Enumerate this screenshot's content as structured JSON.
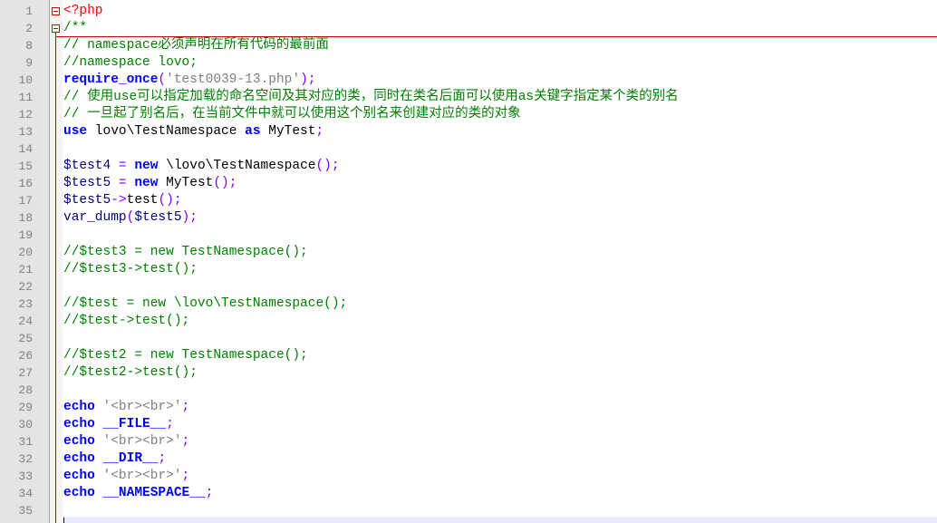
{
  "editor": {
    "line_numbers": [
      "1",
      "2",
      "8",
      "9",
      "10",
      "11",
      "12",
      "13",
      "14",
      "15",
      "16",
      "17",
      "18",
      "19",
      "20",
      "21",
      "22",
      "23",
      "24",
      "25",
      "26",
      "27",
      "28",
      "29",
      "30",
      "31",
      "32",
      "33",
      "34",
      "35"
    ],
    "lines": [
      [
        {
          "t": "<?php",
          "c": "tg"
        }
      ],
      [
        {
          "t": "/**",
          "c": "cm"
        }
      ],
      [
        {
          "t": "// namespace必须声明在所有代码的最前面",
          "c": "cm"
        }
      ],
      [
        {
          "t": "//namespace lovo;",
          "c": "cm"
        }
      ],
      [
        {
          "t": "require_once",
          "c": "kw"
        },
        {
          "t": "(",
          "c": "pn"
        },
        {
          "t": "'test0039-13.php'",
          "c": "str"
        },
        {
          "t": ");",
          "c": "pn"
        }
      ],
      [
        {
          "t": "// 使用use可以指定加载的命名空间及其对应的类，同时在类名后面可以使用as关键字指定某个类的别名",
          "c": "cm"
        }
      ],
      [
        {
          "t": "// 一旦起了别名后，在当前文件中就可以使用这个别名来创建对应的类的对象",
          "c": "cm"
        }
      ],
      [
        {
          "t": "use",
          "c": "kw"
        },
        {
          "t": " lovo\\TestNamespace ",
          "c": ""
        },
        {
          "t": "as",
          "c": "kw"
        },
        {
          "t": " MyTest",
          "c": ""
        },
        {
          "t": ";",
          "c": "pn"
        }
      ],
      [],
      [
        {
          "t": "$test4",
          "c": "vr"
        },
        {
          "t": " = ",
          "c": "pn"
        },
        {
          "t": "new",
          "c": "kw"
        },
        {
          "t": " \\lovo\\TestNamespace",
          "c": ""
        },
        {
          "t": "();",
          "c": "pn"
        }
      ],
      [
        {
          "t": "$test5",
          "c": "vr"
        },
        {
          "t": " = ",
          "c": "pn"
        },
        {
          "t": "new",
          "c": "kw"
        },
        {
          "t": " MyTest",
          "c": ""
        },
        {
          "t": "();",
          "c": "pn"
        }
      ],
      [
        {
          "t": "$test5",
          "c": "vr"
        },
        {
          "t": "->",
          "c": "pn"
        },
        {
          "t": "test",
          "c": ""
        },
        {
          "t": "();",
          "c": "pn"
        }
      ],
      [
        {
          "t": "var_dump",
          "c": "fn"
        },
        {
          "t": "(",
          "c": "pn"
        },
        {
          "t": "$test5",
          "c": "vr"
        },
        {
          "t": ");",
          "c": "pn"
        }
      ],
      [],
      [
        {
          "t": "//$test3 = new TestNamespace();",
          "c": "cm"
        }
      ],
      [
        {
          "t": "//$test3->test();",
          "c": "cm"
        }
      ],
      [],
      [
        {
          "t": "//$test = new \\lovo\\TestNamespace();",
          "c": "cm"
        }
      ],
      [
        {
          "t": "//$test->test();",
          "c": "cm"
        }
      ],
      [],
      [
        {
          "t": "//$test2 = new TestNamespace();",
          "c": "cm"
        }
      ],
      [
        {
          "t": "//$test2->test();",
          "c": "cm"
        }
      ],
      [],
      [
        {
          "t": "echo",
          "c": "kw"
        },
        {
          "t": " ",
          "c": ""
        },
        {
          "t": "'<br><br>'",
          "c": "str"
        },
        {
          "t": ";",
          "c": "pn"
        }
      ],
      [
        {
          "t": "echo",
          "c": "kw"
        },
        {
          "t": " ",
          "c": ""
        },
        {
          "t": "__FILE__",
          "c": "kw"
        },
        {
          "t": ";",
          "c": "pn"
        }
      ],
      [
        {
          "t": "echo",
          "c": "kw"
        },
        {
          "t": " ",
          "c": ""
        },
        {
          "t": "'<br><br>'",
          "c": "str"
        },
        {
          "t": ";",
          "c": "pn"
        }
      ],
      [
        {
          "t": "echo",
          "c": "kw"
        },
        {
          "t": " ",
          "c": ""
        },
        {
          "t": "__DIR__",
          "c": "kw"
        },
        {
          "t": ";",
          "c": "pn"
        }
      ],
      [
        {
          "t": "echo",
          "c": "kw"
        },
        {
          "t": " ",
          "c": ""
        },
        {
          "t": "'<br><br>'",
          "c": "str"
        },
        {
          "t": ";",
          "c": "pn"
        }
      ],
      [
        {
          "t": "echo",
          "c": "kw"
        },
        {
          "t": " ",
          "c": ""
        },
        {
          "t": "__NAMESPACE__",
          "c": "kw"
        },
        {
          "t": ";",
          "c": "pn"
        }
      ],
      []
    ]
  }
}
